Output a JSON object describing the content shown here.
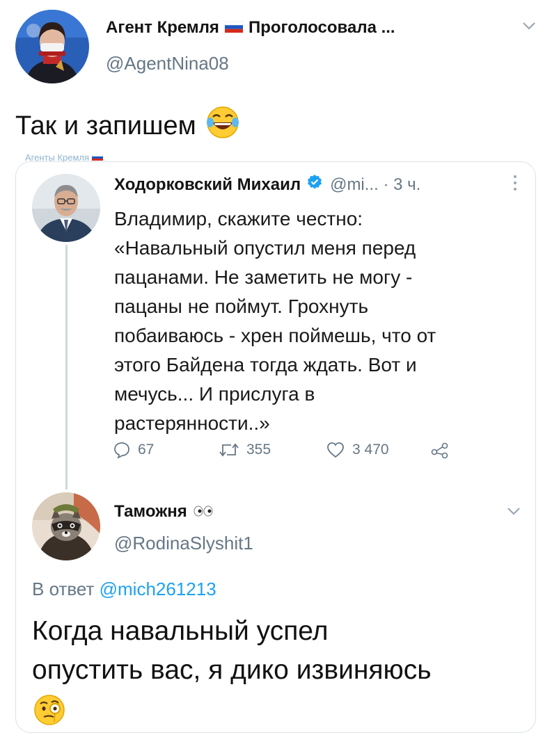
{
  "tweet": {
    "author_name": "Агент Кремля",
    "flag_icon": "russian-flag-icon",
    "author_name_suffix": "Проголосовала ...",
    "author_handle": "@AgentNina08",
    "text": "Так и запишем",
    "emoji": "laughing-tears-emoji",
    "watermark": "Агенты Кремля"
  },
  "quoted_tweet": {
    "author_name": "Ходорковский Михаил",
    "meta": "@mi... · 3 ч.",
    "lines": [
      "Владимир, скажите честно:",
      "«Навальный опустил меня перед",
      "пацанами. Не заметить не могу -",
      "пацаны не поймут. Грохнуть",
      "побаиваюсь - хрен поймешь, что от",
      "этого Байдена тогда ждать. Вот и",
      "мечусь... И прислуга в",
      "растерянности..»"
    ],
    "actions": {
      "replies": "67",
      "retweets": "355",
      "likes": "3 470"
    }
  },
  "reply": {
    "author_name": "Таможня",
    "author_emoji": "eyes-emoji",
    "author_handle": "@RodinaSlyshit1",
    "reply_prefix": "В ответ",
    "reply_mention": "@mich261213",
    "lines": [
      "Когда навальный успел",
      "опустить вас, я дико извиняюсь"
    ],
    "emoji": "monocle-face-emoji"
  },
  "colors": {
    "link": "#1da1f2",
    "secondary_text": "#657786",
    "verified": "#1da1f2",
    "border": "#dbe2e8"
  }
}
